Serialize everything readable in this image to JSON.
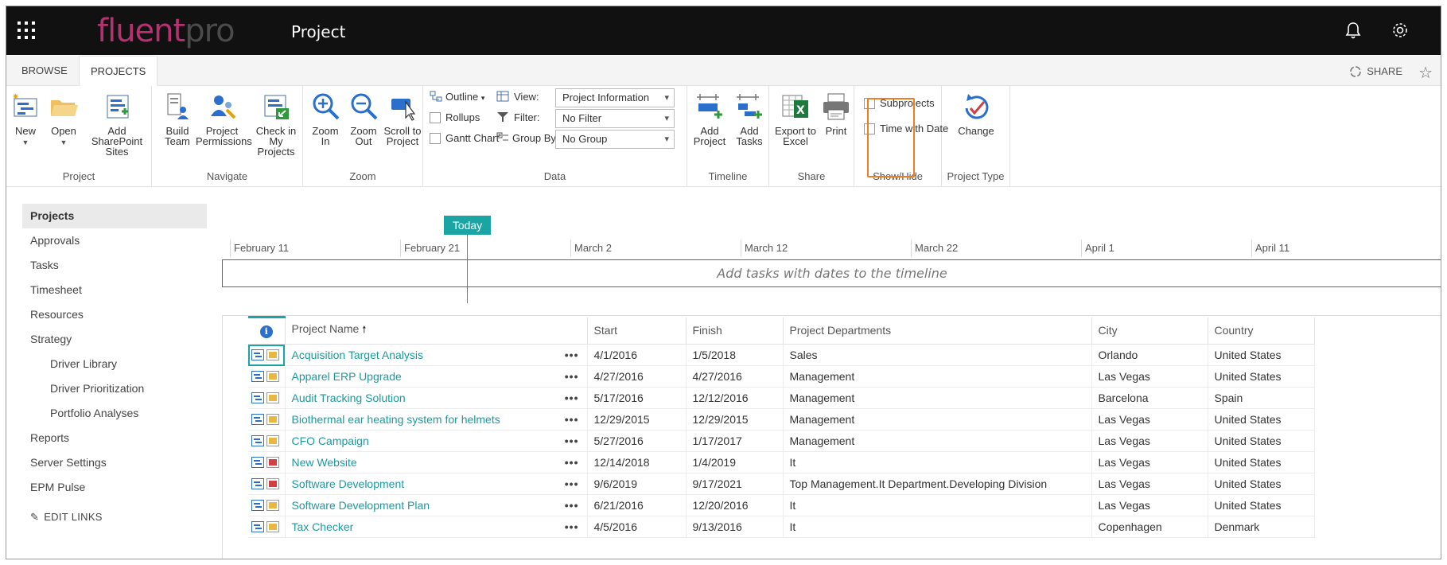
{
  "suite": {
    "logo_a": "fluent",
    "logo_b": "pro",
    "title": "Project"
  },
  "tabs": {
    "browse": "BROWSE",
    "projects": "PROJECTS",
    "share": "SHARE"
  },
  "ribbon": {
    "project": {
      "label": "Project",
      "new": "New",
      "open": "Open",
      "add_sites": "Add SharePoint\nSites"
    },
    "navigate": {
      "label": "Navigate",
      "build_team": "Build\nTeam",
      "permissions": "Project\nPermissions",
      "checkin": "Check in My\nProjects"
    },
    "zoom": {
      "label": "Zoom",
      "zoom_in": "Zoom\nIn",
      "zoom_out": "Zoom\nOut",
      "scroll": "Scroll to\nProject"
    },
    "data": {
      "label": "Data",
      "outline": "Outline",
      "rollups": "Rollups",
      "gantt": "Gantt Chart",
      "view_label": "View:",
      "view_value": "Project Information",
      "filter_label": "Filter:",
      "filter_value": "No Filter",
      "group_label": "Group By:",
      "group_value": "No Group"
    },
    "timeline": {
      "label": "Timeline",
      "add_project": "Add\nProject",
      "add_tasks": "Add\nTasks"
    },
    "share": {
      "label": "Share",
      "export": "Export to\nExcel",
      "print": "Print"
    },
    "showhide": {
      "label": "Show/Hide",
      "subprojects": "Subprojects",
      "time_with_date": "Time with Date"
    },
    "ptype": {
      "label": "Project Type",
      "change": "Change"
    }
  },
  "nav": {
    "items": [
      {
        "label": "Projects"
      },
      {
        "label": "Approvals"
      },
      {
        "label": "Tasks"
      },
      {
        "label": "Timesheet"
      },
      {
        "label": "Resources"
      },
      {
        "label": "Strategy"
      },
      {
        "label": "Driver Library"
      },
      {
        "label": "Driver Prioritization"
      },
      {
        "label": "Portfolio Analyses"
      },
      {
        "label": "Reports"
      },
      {
        "label": "Server Settings"
      },
      {
        "label": "EPM Pulse"
      }
    ],
    "edit_links": "EDIT LINKS"
  },
  "timeline": {
    "today": "Today",
    "dates": [
      "February 11",
      "February 21",
      "March 2",
      "March 12",
      "March 22",
      "April 1",
      "April 11"
    ],
    "placeholder": "Add tasks with dates to the timeline"
  },
  "grid": {
    "headers": {
      "name": "Project Name",
      "start": "Start",
      "finish": "Finish",
      "departments": "Project Departments",
      "city": "City",
      "country": "Country"
    },
    "sort_arrow": "🠕",
    "rows": [
      {
        "name": "Acquisition Target Analysis",
        "start": "4/1/2016",
        "finish": "1/5/2018",
        "dept": "Sales",
        "city": "Orlando",
        "country": "United States"
      },
      {
        "name": "Apparel ERP Upgrade",
        "start": "4/27/2016",
        "finish": "4/27/2016",
        "dept": "Management",
        "city": "Las Vegas",
        "country": "United States"
      },
      {
        "name": "Audit Tracking Solution",
        "start": "5/17/2016",
        "finish": "12/12/2016",
        "dept": "Management",
        "city": "Barcelona",
        "country": "Spain"
      },
      {
        "name": "Biothermal ear heating system for helmets",
        "start": "12/29/2015",
        "finish": "12/29/2015",
        "dept": "Management",
        "city": "Las Vegas",
        "country": "United States"
      },
      {
        "name": "CFO Campaign",
        "start": "5/27/2016",
        "finish": "1/17/2017",
        "dept": "Management",
        "city": "Las Vegas",
        "country": "United States"
      },
      {
        "name": "New Website",
        "start": "12/14/2018",
        "finish": "1/4/2019",
        "dept": "It",
        "city": "Las Vegas",
        "country": "United States"
      },
      {
        "name": "Software Development",
        "start": "9/6/2019",
        "finish": "9/17/2021",
        "dept": "Top Management.It Department.Developing Division",
        "city": "Las Vegas",
        "country": "United States"
      },
      {
        "name": "Software Development Plan",
        "start": "6/21/2016",
        "finish": "12/20/2016",
        "dept": "It",
        "city": "Las Vegas",
        "country": "United States"
      },
      {
        "name": "Tax Checker",
        "start": "4/5/2016",
        "finish": "9/13/2016",
        "dept": "It",
        "city": "Copenhagen",
        "country": "Denmark"
      }
    ],
    "row_dots": "•••"
  },
  "colors": {
    "accent": "#1aa4a4",
    "brand": "#b5316f",
    "link": "#1b9aa0",
    "highlight": "#f07d20"
  }
}
